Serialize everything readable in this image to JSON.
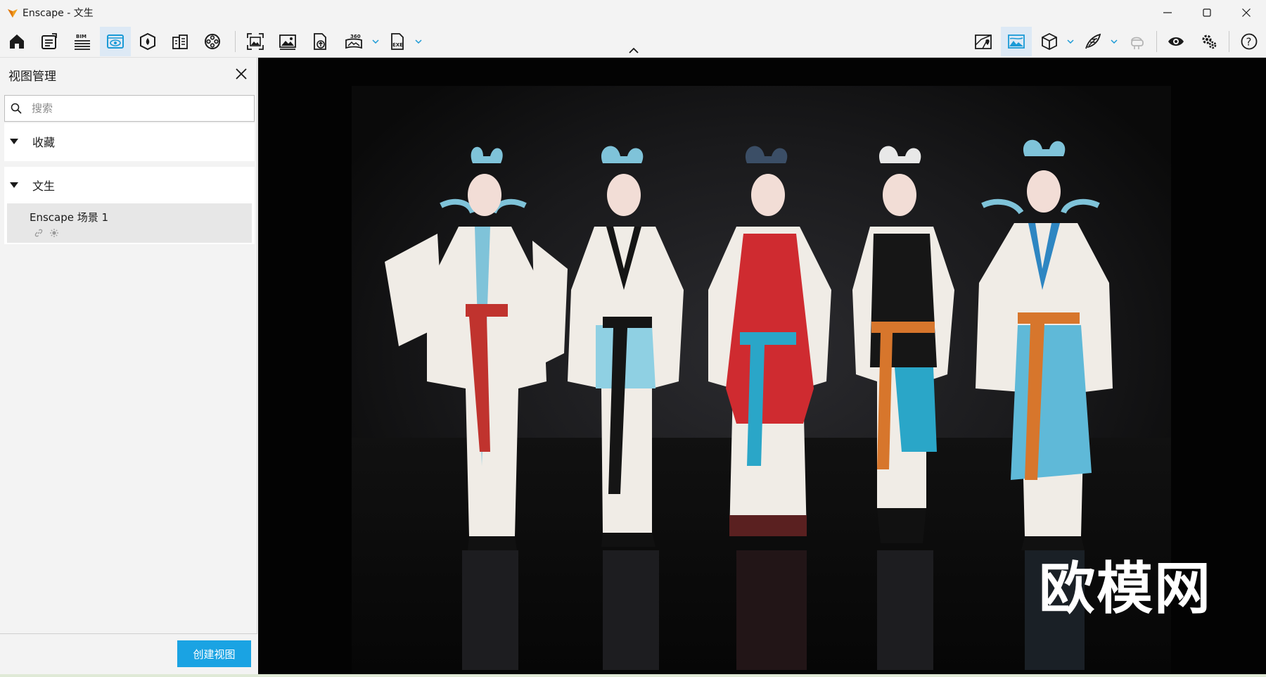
{
  "window": {
    "title": "Enscape - 文生",
    "logo_icon": "enscape-logo-icon",
    "controls": [
      "minimize-icon",
      "maximize-icon",
      "close-icon"
    ]
  },
  "toolbar": {
    "left_tools": [
      {
        "name": "home",
        "icon": "home-icon"
      },
      {
        "name": "notes",
        "icon": "notes-icon"
      },
      {
        "name": "bim",
        "icon": "bim-info-icon",
        "label": "BIM"
      },
      {
        "name": "view-management",
        "icon": "eye-view-icon",
        "active": true
      },
      {
        "name": "assets",
        "icon": "asset-library-icon"
      },
      {
        "name": "material-editor",
        "icon": "material-icon"
      },
      {
        "name": "video-editor",
        "icon": "video-reel-icon"
      },
      {
        "name": "screenshot",
        "icon": "screenshot-icon"
      },
      {
        "name": "batch-render",
        "icon": "image-gallery-icon"
      },
      {
        "name": "web-standalone",
        "icon": "upload-file-icon"
      },
      {
        "name": "panorama",
        "icon": "panorama-360-icon",
        "label": "360"
      },
      {
        "name": "export-exe",
        "icon": "exe-export-icon",
        "label": "EXE"
      }
    ],
    "right_tools": [
      {
        "name": "map",
        "icon": "map-icon"
      },
      {
        "name": "atmosphere",
        "icon": "landscape-icon",
        "active": true
      },
      {
        "name": "cube",
        "icon": "cube-icon"
      },
      {
        "name": "feather",
        "icon": "feather-icon"
      },
      {
        "name": "vr",
        "icon": "vr-headset-icon"
      },
      {
        "name": "visual-settings",
        "icon": "eye-settings-icon"
      },
      {
        "name": "settings",
        "icon": "gears-icon"
      },
      {
        "name": "help",
        "icon": "help-icon",
        "label": "?"
      }
    ]
  },
  "panel": {
    "title": "视图管理",
    "search_placeholder": "搜索",
    "sections": [
      {
        "label": "收藏",
        "expanded": true,
        "items": []
      },
      {
        "label": "文生",
        "expanded": true,
        "items": [
          {
            "name": "Enscape 场景 1",
            "icons": [
              "link-icon",
              "sun-icon"
            ]
          }
        ]
      }
    ],
    "create_button": "创建视图"
  },
  "viewport": {
    "watermark": "欧模网"
  }
}
